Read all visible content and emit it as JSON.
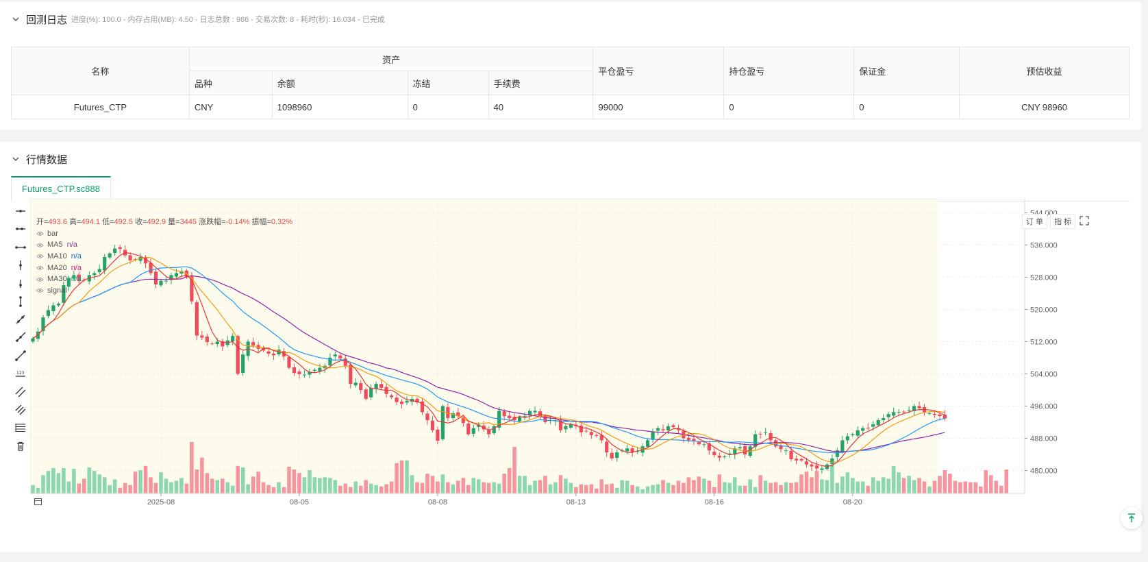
{
  "log_panel": {
    "title": "回测日志",
    "meta": "进度(%): 100.0 - 内存占用(MB): 4.50 - 日志总数 : 966 - 交易次数:  8 - 耗时(秒): 16.034 - 已完成",
    "table": {
      "headers": {
        "name": "名称",
        "asset_group": "资产",
        "variety": "品种",
        "balance": "余额",
        "frozen": "冻结",
        "fee": "手续费",
        "closed_pnl": "平仓盈亏",
        "position_pnl": "持仓盈亏",
        "margin": "保证金",
        "est_profit": "预估收益"
      },
      "row": {
        "name": "Futures_CTP",
        "variety": "CNY",
        "balance": "1098960",
        "frozen": "0",
        "fee": "40",
        "closed_pnl": "99000",
        "position_pnl": "0",
        "margin": "0",
        "est_profit": "CNY 98960"
      }
    }
  },
  "market_panel": {
    "title": "行情数据",
    "tab": "Futures_CTP.sc888",
    "buttons": {
      "order": "订 单",
      "indicator": "指 标"
    },
    "ohlc": {
      "open_label": "开=",
      "open": "493.6",
      "high_label": "高=",
      "high": "494.1",
      "low_label": "低=",
      "low": "492.5",
      "close_label": "收=",
      "close": "492.9",
      "vol_label": "量=",
      "vol": "3445",
      "chg_label": "涨跌幅=",
      "chg": "-0.14%",
      "amp_label": "振幅=",
      "amp": "0.32%"
    },
    "legend": [
      {
        "name": "bar",
        "value": ""
      },
      {
        "name": "MA5",
        "value": "n/a",
        "color": "#7b3fa0"
      },
      {
        "name": "MA10",
        "value": "n/a",
        "color": "#1e6fd9"
      },
      {
        "name": "MA20",
        "value": "n/a",
        "color": "#d81b60"
      },
      {
        "name": "MA30",
        "value": "n/a",
        "color": "#16a085"
      },
      {
        "name": "signal",
        "value": ""
      }
    ],
    "toolbar_icons": [
      "horizontal-line-icon",
      "horizontal-ray-icon",
      "horizontal-segment-icon",
      "vertical-line-icon",
      "vertical-ray-icon",
      "vertical-segment-icon",
      "trend-line-icon",
      "ray-line-icon",
      "segment-line-icon",
      "price-label-icon",
      "parallel-channel-icon",
      "price-channel-icon",
      "fibonacci-icon",
      "trash-icon"
    ]
  },
  "chart_data": {
    "type": "candlestick",
    "y_ticks": [
      "544.000",
      "536.000",
      "528.000",
      "520.000",
      "512.000",
      "504.000",
      "496.000",
      "488.000",
      "480.000"
    ],
    "ylim": [
      474.3,
      546.1
    ],
    "x_ticks": [
      {
        "label": "2025-08",
        "index": 25
      },
      {
        "label": "08-05",
        "index": 52
      },
      {
        "label": "08-08",
        "index": 79
      },
      {
        "label": "08-13",
        "index": 106
      },
      {
        "label": "08-16",
        "index": 133
      },
      {
        "label": "08-20",
        "index": 160
      }
    ],
    "up_color": "#26a269",
    "down_color": "#ef4b5a",
    "colors": {
      "ma5": "#e53935",
      "ma10": "#f39c12",
      "ma20": "#2196f3",
      "ma30": "#8e24aa",
      "highlight_bg": "#fdfbec"
    },
    "close": [
      512.8,
      514.5,
      518.0,
      519.8,
      521.0,
      521.4,
      526.0,
      527.8,
      528.5,
      527.0,
      527.2,
      528.5,
      529.0,
      530.0,
      533.0,
      533.9,
      535.1,
      535.0,
      533.4,
      532.2,
      532.4,
      533.0,
      531.4,
      529.0,
      526.2,
      527.1,
      527.1,
      528.5,
      529.0,
      529.5,
      528.0,
      522.0,
      513.5,
      513.0,
      511.9,
      511.5,
      512.0,
      510.8,
      512.3,
      513.4,
      504.0,
      508.8,
      512.0,
      511.0,
      510.2,
      509.8,
      509.0,
      508.6,
      510.0,
      508.3,
      505.5,
      504.2,
      503.9,
      503.8,
      504.5,
      505.0,
      505.5,
      506.0,
      508.0,
      508.8,
      507.8,
      506.0,
      501.5,
      501.8,
      500.0,
      497.8,
      500.5,
      501.5,
      500.5,
      499.0,
      498.2,
      497.0,
      496.5,
      497.3,
      497.8,
      496.9,
      494.5,
      492.5,
      490.0,
      487.4,
      496.0,
      493.0,
      494.2,
      493.5,
      491.8,
      489.0,
      490.5,
      491.4,
      490.2,
      489.0,
      491.0,
      494.8,
      493.5,
      493.0,
      492.5,
      493.3,
      493.5,
      494.8,
      494.8,
      493.5,
      492.0,
      492.5,
      492.5,
      490.0,
      491.0,
      491.5,
      491.0,
      489.5,
      489.8,
      488.8,
      488.6,
      487.5,
      484.5,
      483.0,
      484.5,
      485.0,
      485.5,
      484.5,
      484.8,
      486.0,
      487.5,
      489.5,
      490.5,
      490.0,
      491.0,
      490.8,
      490.0,
      488.0,
      487.5,
      487.3,
      486.5,
      486.5,
      485.0,
      483.8,
      483.2,
      483.5,
      484.2,
      485.5,
      485.8,
      484.0,
      486.0,
      489.0,
      489.0,
      489.5,
      487.5,
      486.0,
      485.3,
      485.0,
      482.8,
      482.5,
      482.5,
      481.5,
      481.0,
      480.5,
      480.5,
      481.5,
      483.0,
      485.0,
      487.5,
      488.5,
      489.0,
      490.0,
      490.5,
      490.5,
      491.5,
      492.5,
      493.0,
      494.0,
      494.5,
      494.5,
      494.6,
      495.0,
      496.0,
      495.5,
      494.5,
      494.2,
      493.8,
      493.5,
      492.9
    ],
    "volume": [
      1200,
      800,
      2600,
      3200,
      3600,
      2900,
      3600,
      1700,
      3500,
      1400,
      2100,
      3700,
      3200,
      2700,
      2300,
      1200,
      2000,
      800,
      1500,
      1200,
      3100,
      3300,
      3900,
      2300,
      1500,
      3000,
      2100,
      1600,
      1800,
      2200,
      1400,
      7300,
      3400,
      5100,
      2900,
      2100,
      1900,
      2100,
      1600,
      1100,
      3900,
      3700,
      1300,
      2400,
      3100,
      1600,
      1200,
      900,
      1600,
      900,
      3800,
      3400,
      2900,
      2300,
      3300,
      2300,
      2200,
      2300,
      2200,
      1900,
      1100,
      1400,
      900,
      1700,
      1100,
      1900,
      1400,
      1200,
      1000,
      1300,
      1700,
      4300,
      4700,
      4700,
      2600,
      1600,
      1500,
      2800,
      2500,
      1700,
      2700,
      1600,
      1300,
      1800,
      2200,
      1200,
      2200,
      2000,
      1600,
      1500,
      1600,
      1400,
      2800,
      3600,
      6600,
      2500,
      2500,
      1200,
      1800,
      1900,
      2500,
      1300,
      1600,
      2600,
      2100,
      1500,
      900,
      1300,
      1200,
      1300,
      700,
      2000,
      1300,
      1400,
      800,
      1900,
      1800,
      1200,
      1000,
      600,
      1000,
      1200,
      1300,
      1900,
      1500,
      1200,
      1800,
      1500,
      2300,
      1900,
      2400,
      2100,
      1800,
      900,
      2700,
      1600,
      1500,
      2300,
      1100,
      1100,
      2000,
      900,
      2600,
      1800,
      1500,
      1600,
      1200,
      1600,
      1500,
      1600,
      2700,
      3100,
      2300,
      3200,
      2000,
      1900,
      4100,
      1500,
      2400,
      3000,
      2200,
      1700,
      1700,
      1100,
      2300,
      1800,
      2300,
      2100,
      3900,
      3000,
      2200,
      2500,
      1900,
      2200,
      1700,
      1000,
      1800,
      2500,
      3300,
      2800,
      1800,
      1600,
      1700,
      1600,
      1600,
      1000,
      3300,
      2600,
      1800,
      1100,
      3400
    ]
  }
}
